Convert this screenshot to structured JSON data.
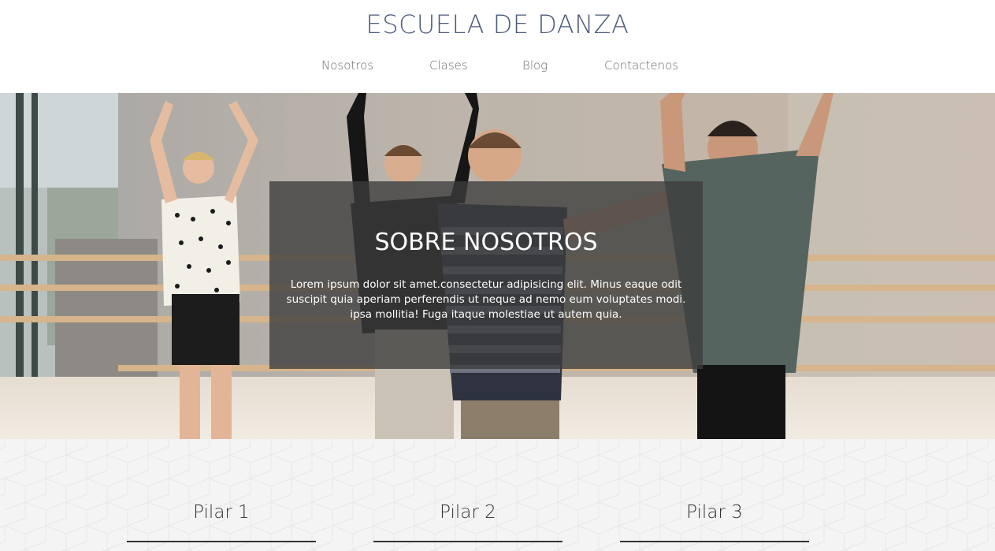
{
  "header": {
    "title": "ESCUELA DE DANZA",
    "nav": [
      "Nosotros",
      "Clases",
      "Blog",
      "Contactenos"
    ]
  },
  "hero": {
    "title": "SOBRE NOSOTROS",
    "text": "Lorem ipsum dolor sit amet.consectetur adipisicing elit. Minus eaque odit suscipit quia aperiam perferendis ut neque ad nemo eum voluptates modi. ipsa mollitia! Fuga itaque molestiae ut autem quia."
  },
  "pillars": [
    "Pilar 1",
    "Pilar 2",
    "Pilar 3"
  ],
  "colors": {
    "title": "#4c5a7c",
    "nav": "#6b6b6b",
    "overlay": "#3c3c3c",
    "pillars_bg": "#f4f4f4"
  }
}
